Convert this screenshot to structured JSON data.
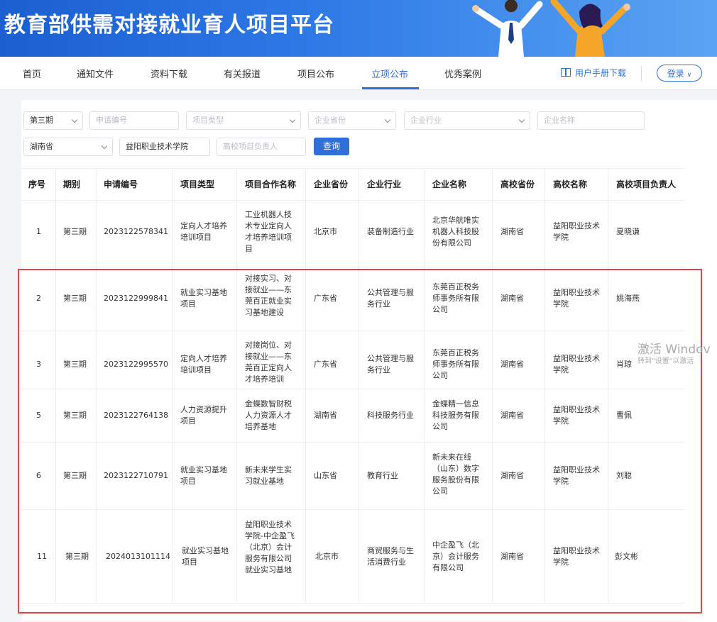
{
  "banner": {
    "title": "教育部供需对接就业育人项目平台"
  },
  "nav": {
    "items": [
      "首页",
      "通知文件",
      "资料下载",
      "有关报道",
      "项目公布",
      "立项公布",
      "优秀案例"
    ],
    "active_index": 5,
    "manual_label": "用户手册下载",
    "login_label": "登录"
  },
  "filters": {
    "period": "第三期",
    "application_no_placeholder": "申请编号",
    "project_type_placeholder": "项目类型",
    "enterprise_province_placeholder": "企业省份",
    "enterprise_industry_placeholder": "企业行业",
    "enterprise_name_placeholder": "企业名称",
    "school_province": "湖南省",
    "school_name": "益阳职业技术学院",
    "school_leader_placeholder": "高校项目负责人",
    "query_label": "查询"
  },
  "table": {
    "headers": [
      "序号",
      "期别",
      "申请编号",
      "项目类型",
      "项目合作名称",
      "企业省份",
      "企业行业",
      "企业名称",
      "高校省份",
      "高校名称",
      "高校项目负责人"
    ],
    "rows": [
      [
        "1",
        "第三期",
        "2023122578341",
        "定向人才培养培训项目",
        "工业机器人技术专业定向人才培养培训项目",
        "北京市",
        "装备制造行业",
        "北京华航唯实机器人科技股份有限公司",
        "湖南省",
        "益阳职业技术学院",
        "夏晓谦"
      ],
      [
        "2",
        "第三期",
        "2023122999841",
        "就业实习基地项目",
        "对接实习、对接就业——东莞百正就业实习基地建设",
        "广东省",
        "公共管理与服务行业",
        "东莞百正税务师事务所有限公司",
        "湖南省",
        "益阳职业技术学院",
        "姚海燕"
      ],
      [
        "3",
        "第三期",
        "2023122995570",
        "定向人才培养培训项目",
        "对接岗位、对接就业——东莞百正定向人才培养培训",
        "广东省",
        "公共管理与服务行业",
        "东莞百正税务师事务所有限公司",
        "湖南省",
        "益阳职业技术学院",
        "肖琼"
      ],
      [
        "5",
        "第三期",
        "2023122764138",
        "人力资源提升项目",
        "金蝶数智财税人力资源人才培养基地",
        "湖南省",
        "科技服务行业",
        "金蝶精一信息科技服务有限公司",
        "湖南省",
        "益阳职业技术学院",
        "曹佩"
      ],
      [
        "6",
        "第三期",
        "2023122710791",
        "就业实习基地项目",
        "新未来学生实习就业基地",
        "山东省",
        "教育行业",
        "新未来在线（山东）数字服务股份有限公司",
        "湖南省",
        "益阳职业技术学院",
        "刘聪"
      ],
      [
        "11",
        "第三期",
        "2024013101114",
        "就业实习基地项目",
        "益阳职业技术学院-中企盈飞（北京）会计服务有限公司就业实习基地",
        "北京市",
        "商贸服务与生活消费行业",
        "中企盈飞（北京）会计服务有限公司",
        "湖南省",
        "益阳职业技术学院",
        "彭文彬"
      ]
    ]
  },
  "watermark": {
    "line1": "激活 Windov",
    "line2": "转到\"设置\"以激活"
  },
  "colors": {
    "primary": "#2f6fd6",
    "highlight_box": "#e04545"
  }
}
